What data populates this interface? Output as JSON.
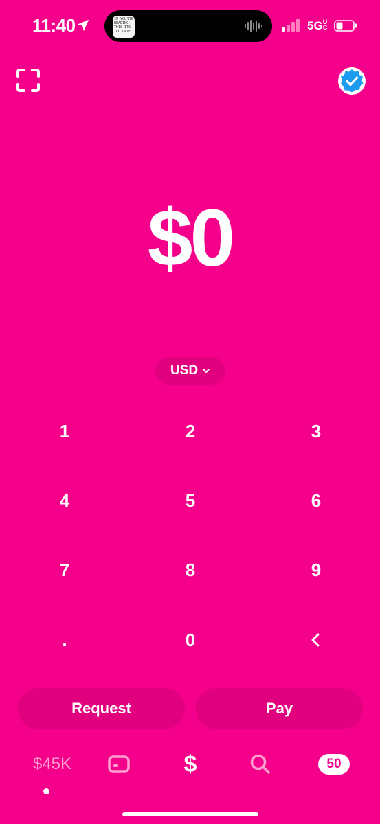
{
  "status_bar": {
    "time": "11:40",
    "network": "5G",
    "network_suffix": "UC",
    "island_thumbnail_text": "IF YOU'RE\nREADING\nTHIS ITS\nTOO LATE"
  },
  "header": {
    "scan_icon": "qr-scan-icon",
    "profile_icon": "verified-badge-icon"
  },
  "amount": {
    "value": "$0"
  },
  "currency": {
    "selected": "USD"
  },
  "keypad": {
    "keys": [
      "1",
      "2",
      "3",
      "4",
      "5",
      "6",
      "7",
      "8",
      "9",
      ".",
      "0"
    ]
  },
  "actions": {
    "request_label": "Request",
    "pay_label": "Pay"
  },
  "tab_bar": {
    "balance_label": "$45K",
    "money_label": "$",
    "activity_count": "50"
  },
  "colors": {
    "background": "#F5008A",
    "button_bg": "#E1007E",
    "verified_blue": "#1D9BF0"
  }
}
